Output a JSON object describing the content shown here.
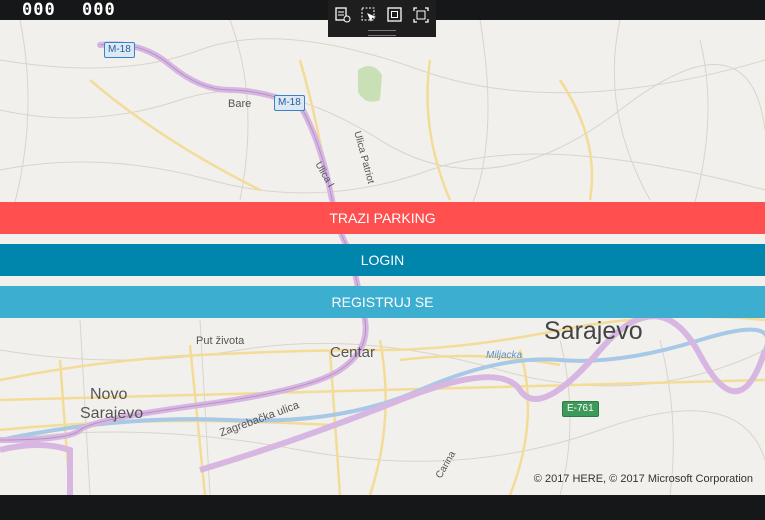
{
  "counters": {
    "left": "000",
    "right": "000"
  },
  "debug_toolbar": {
    "tools": [
      "live-visual-tree-icon",
      "select-element-icon",
      "display-layout-adorners-icon",
      "track-focused-element-icon"
    ]
  },
  "buttons": {
    "parking": "TRAZI PARKING",
    "login": "LOGIN",
    "register": "REGISTRUJ SE"
  },
  "colors": {
    "parking": "#ff4f4f",
    "login": "#0086ad",
    "register": "#3cafd0",
    "map_bg": "#f2f0ec",
    "road_major": "#d5b2de",
    "road_minor": "#fbe9b6"
  },
  "map": {
    "labels": {
      "sarajevo": "Sarajevo",
      "centar": "Centar",
      "novo": "Novo",
      "novo_sarajevo": "Sarajevo",
      "bare": "Bare",
      "put_zivota": "Put života",
      "zagrebacka": "Zagrebačka ulica",
      "miljacka": "Miljacka",
      "ulica_patriot": "Ulica Patriot",
      "ulica_i": "Ulica I",
      "carina": "Carina"
    },
    "shields": {
      "m18_a": "M-18",
      "m18_b": "M-18",
      "e761": "E-761"
    },
    "copyright": "© 2017 HERE, © 2017 Microsoft Corporation"
  }
}
